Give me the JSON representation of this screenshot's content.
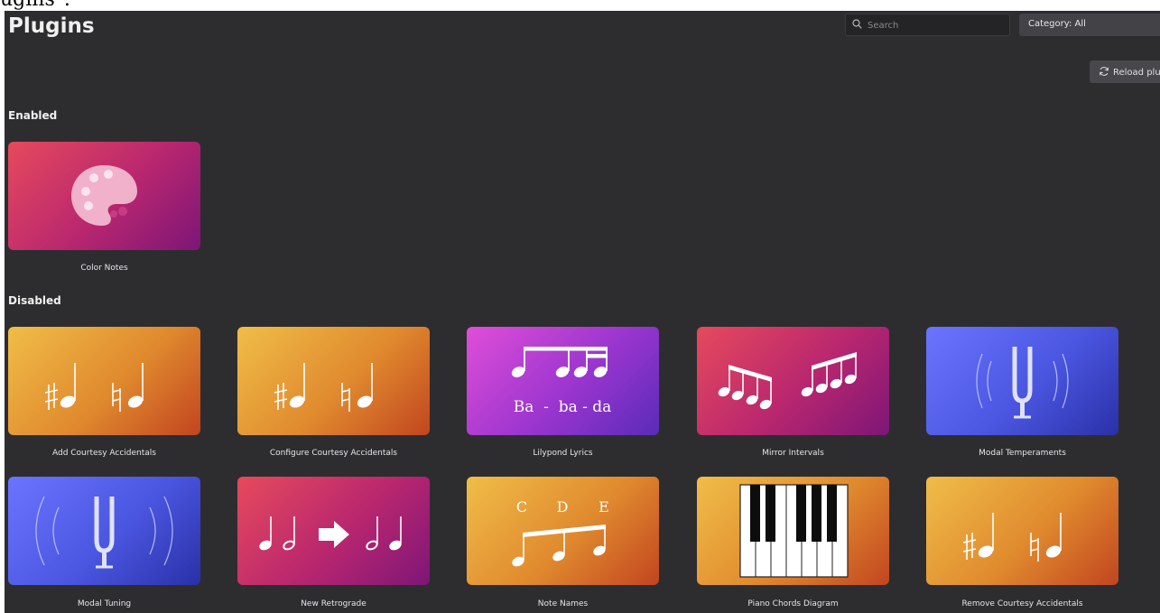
{
  "top_strip": {
    "text": "ugins\"."
  },
  "header": {
    "title": "Plugins",
    "search_placeholder": "Search",
    "category_label": "Category: All",
    "reload_label": "Reload plug"
  },
  "sections": {
    "enabled": "Enabled",
    "disabled": "Disabled"
  },
  "plugins": {
    "color_notes": "Color Notes",
    "add_courtesy": "Add Courtesy Accidentals",
    "configure_courtesy": "Configure Courtesy Accidentals",
    "lilypond_lyrics": "Lilypond Lyrics",
    "mirror_intervals": "Mirror Intervals",
    "modal_temperaments": "Modal Temperaments",
    "modal_tuning": "Modal Tuning",
    "new_retrograde": "New Retrograde",
    "note_names": "Note Names",
    "piano_chords": "Piano Chords Diagram",
    "remove_courtesy": "Remove Courtesy Accidentals"
  },
  "icon_text": {
    "lyrics": "Ba  -  ba - da",
    "note_c": "C",
    "note_d": "D",
    "note_e": "E"
  },
  "icons": {
    "color_notes": "palette-icon",
    "accidentals": "sharp-natural-notes-icon",
    "lyrics": "beamed-notes-icon",
    "mirror": "mirror-intervals-icon",
    "tuning": "tuning-fork-icon",
    "retrograde": "retrograde-arrow-icon",
    "note_names": "note-names-icon",
    "piano": "piano-keys-icon"
  }
}
